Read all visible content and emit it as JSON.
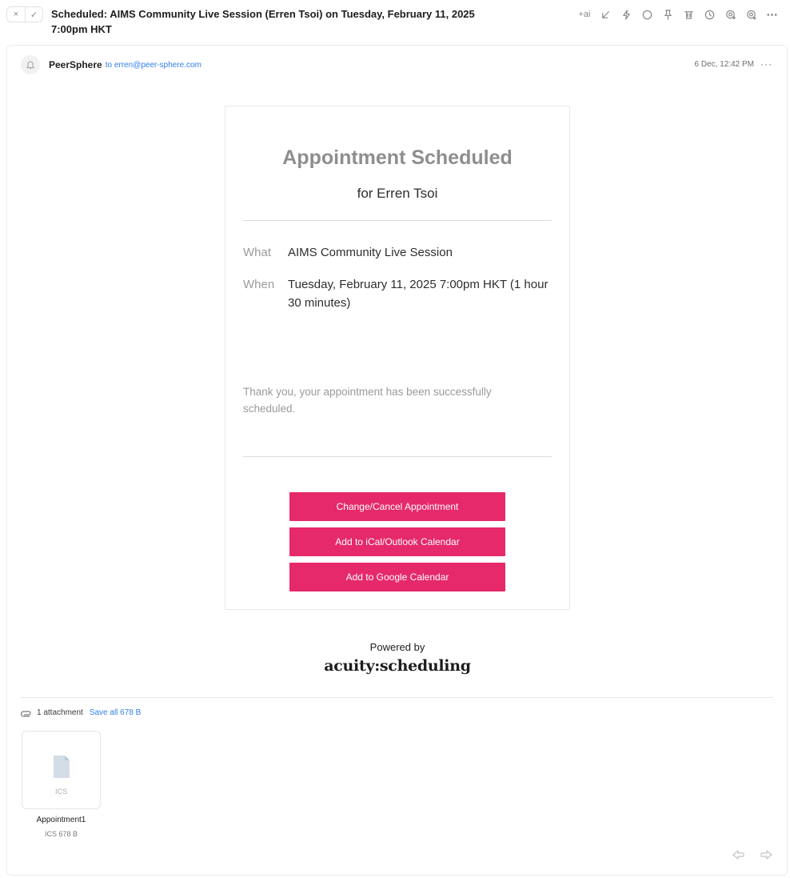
{
  "header": {
    "subject": "Scheduled: AIMS Community Live Session (Erren Tsoi) on Tuesday, February 11, 2025 7:00pm HKT",
    "ai_label": "+ai",
    "close_glyph": "×",
    "check_glyph": "✓",
    "toolbar_icons": [
      "ai-icon",
      "collapse-icon",
      "bolt-icon",
      "circle-icon",
      "pin-icon",
      "trash-icon",
      "clock-icon",
      "mention-icon",
      "add-mention-icon",
      "more-icon"
    ]
  },
  "message": {
    "sender": "PeerSphere",
    "recipient": "to erren@peer-sphere.com",
    "date": "6 Dec, 12:42 PM",
    "more": "···"
  },
  "email": {
    "title": "Appointment Scheduled",
    "for_line": "for Erren Tsoi",
    "what_label": "What",
    "what_value": "AIMS Community Live Session",
    "when_label": "When",
    "when_value": "Tuesday, February 11, 2025 7:00pm HKT (1 hour 30 minutes)",
    "thanks": "Thank you, your appointment has been successfully scheduled.",
    "buttons": {
      "change": "Change/Cancel Appointment",
      "ical": "Add to iCal/Outlook Calendar",
      "google": "Add to Google Calendar"
    },
    "powered_by": "Powered by",
    "brand": "acuity:scheduling"
  },
  "attachments": {
    "count_label": "1 attachment",
    "save_all": "Save all 678 B",
    "files": [
      {
        "ext": "ICS",
        "name": "Appointment1",
        "meta": "ICS 678 B"
      }
    ]
  },
  "colors": {
    "accent": "#e5296a",
    "link": "#2f7fe8",
    "title_gray": "#8e8e8e"
  }
}
